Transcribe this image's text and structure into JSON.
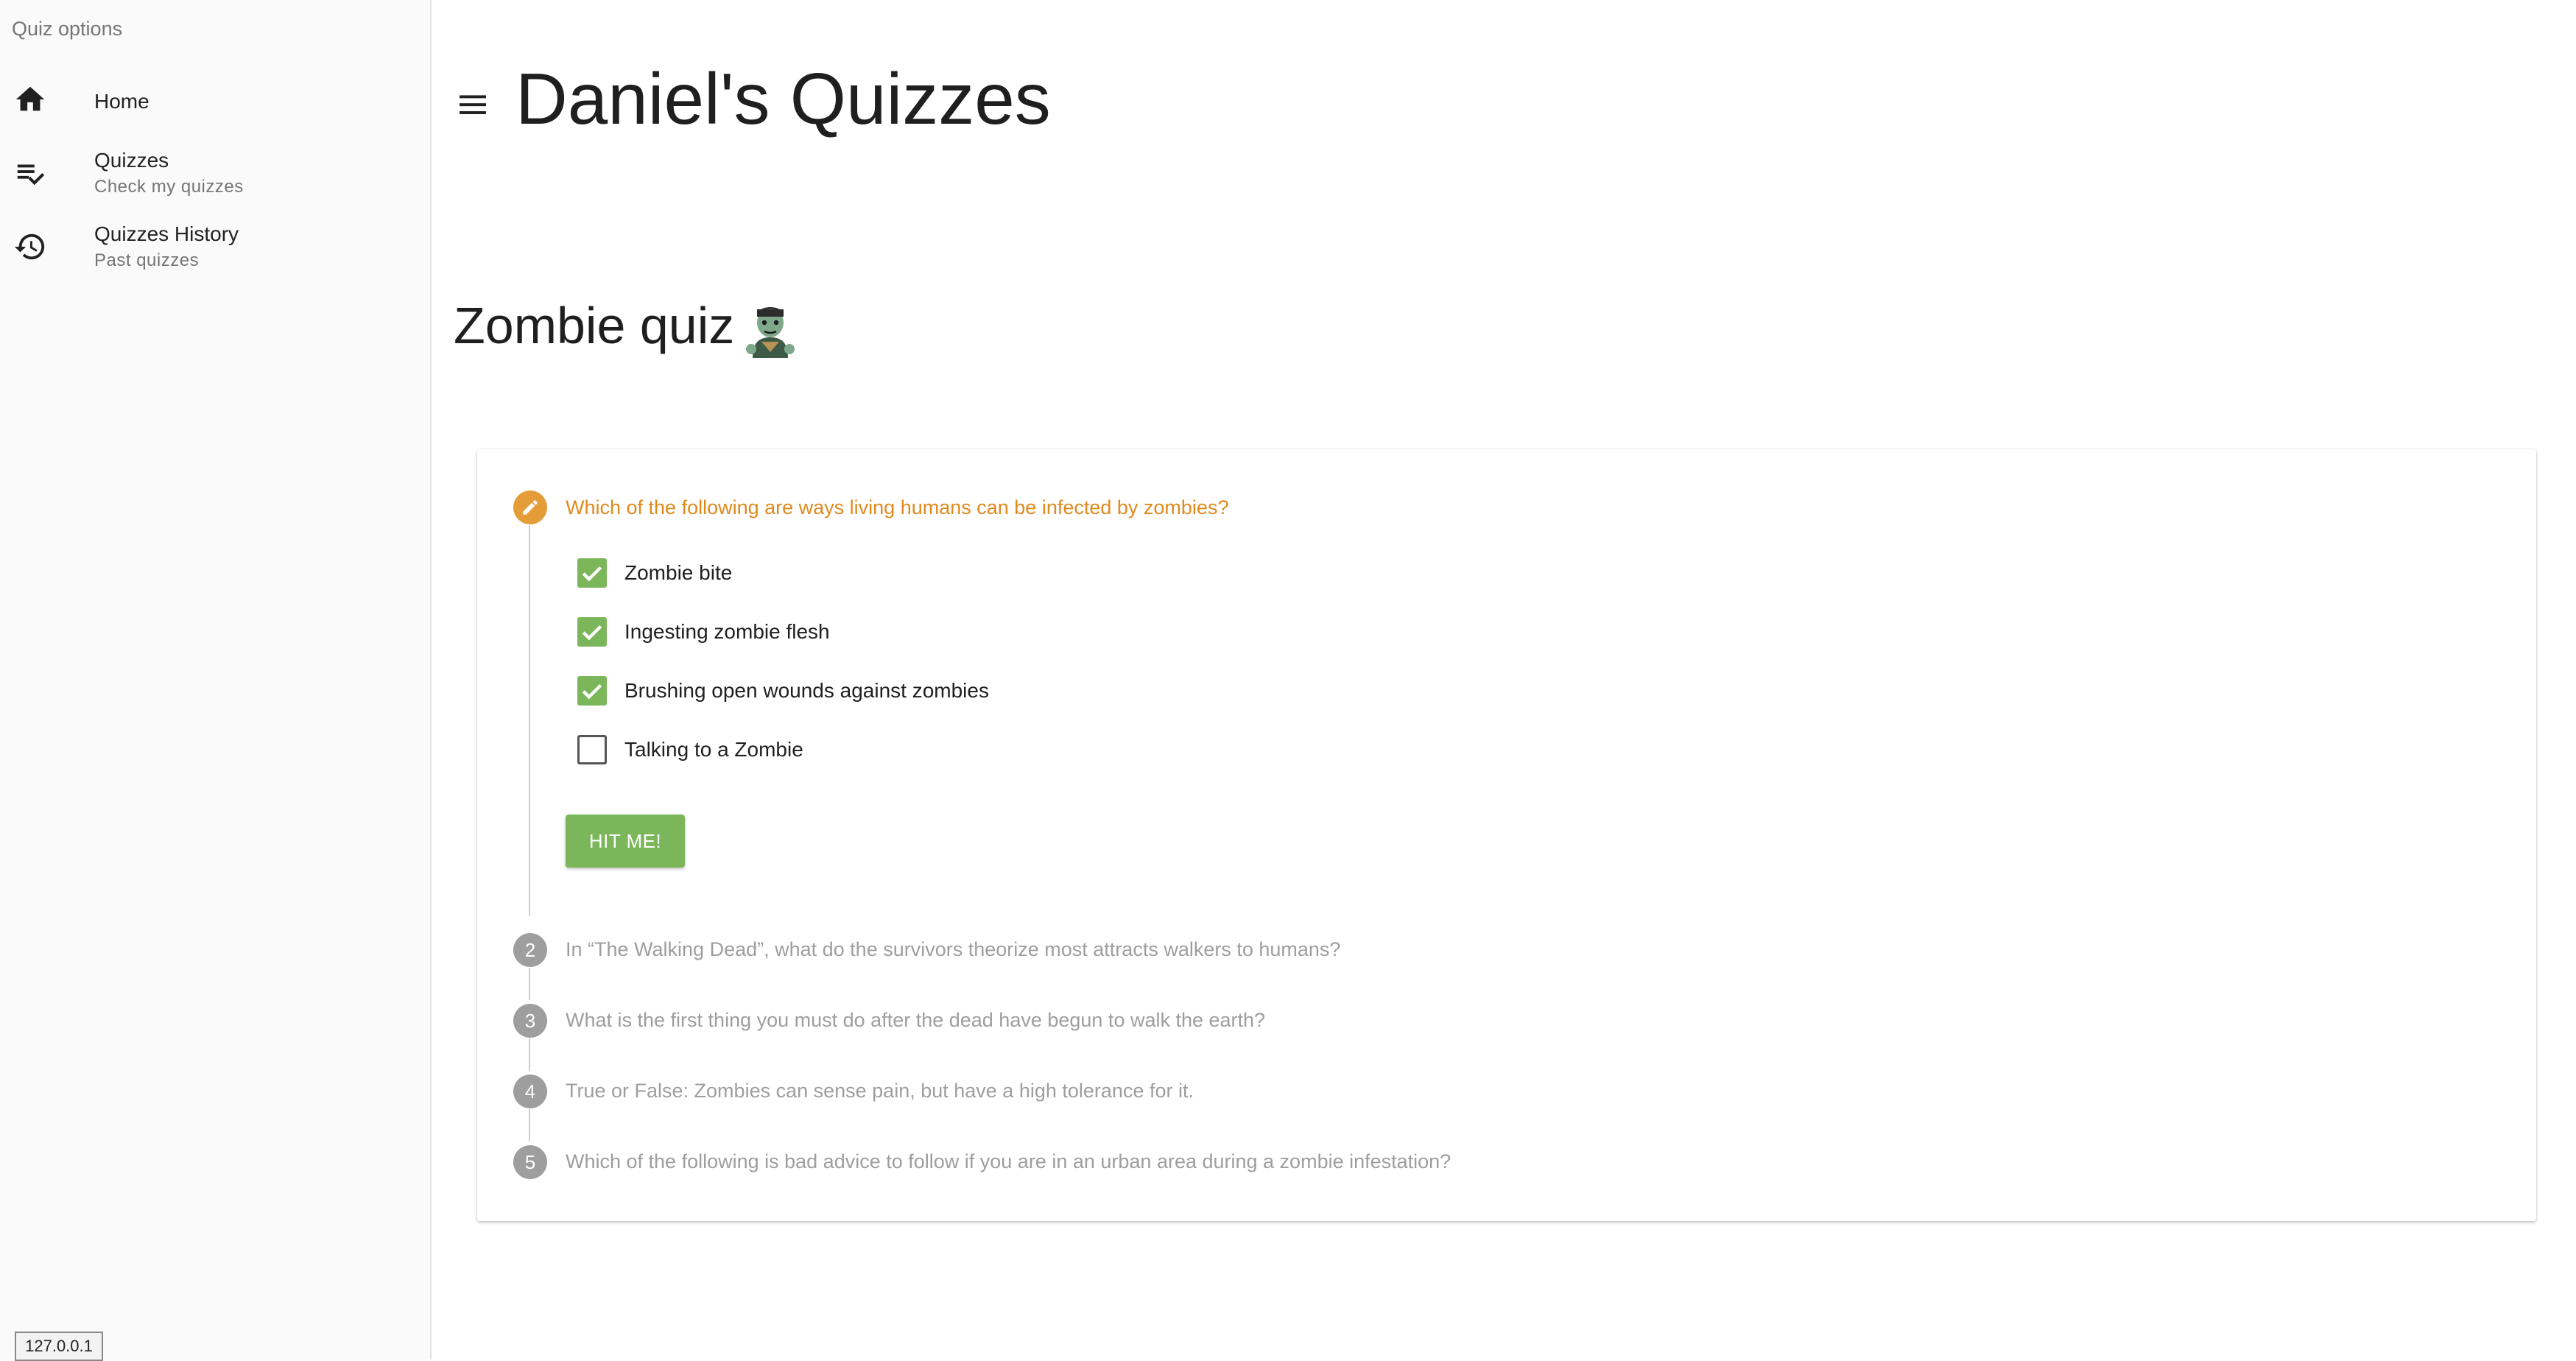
{
  "sidebar": {
    "header": "Quiz options",
    "items": [
      {
        "label": "Home",
        "icon": "home-icon"
      },
      {
        "label": "Quizzes",
        "subtitle": "Check my quizzes",
        "icon": "playlist-check-icon"
      },
      {
        "label": "Quizzes History",
        "subtitle": "Past quizzes",
        "icon": "history-icon"
      }
    ],
    "host": "127.0.0.1"
  },
  "header": {
    "title": "Daniel's Quizzes",
    "menu_icon": "menu-icon"
  },
  "quiz": {
    "title": "Zombie quiz",
    "title_emoji": "zombie-emoji",
    "current_question": "Which of the following are ways living humans can be infected by zombies?",
    "options": [
      {
        "label": "Zombie bite",
        "checked": true
      },
      {
        "label": "Ingesting zombie flesh",
        "checked": true
      },
      {
        "label": "Brushing open wounds against zombies",
        "checked": true
      },
      {
        "label": "Talking to a Zombie",
        "checked": false
      }
    ],
    "submit_label": "HIT ME!",
    "steps": [
      {
        "number": "2",
        "text": "In “The Walking Dead”, what do the survivors theorize most attracts walkers to humans?"
      },
      {
        "number": "3",
        "text": "What is the first thing you must do after the dead have begun to walk the earth?"
      },
      {
        "number": "4",
        "text": "True or False: Zombies can sense pain, but have a high tolerance for it."
      },
      {
        "number": "5",
        "text": "Which of the following is bad advice to follow if you are in an urban area during a zombie infestation?"
      }
    ]
  },
  "colors": {
    "accent": "#e59d3a",
    "checkbox": "#7cb65a",
    "inactive": "#9e9e9e"
  }
}
